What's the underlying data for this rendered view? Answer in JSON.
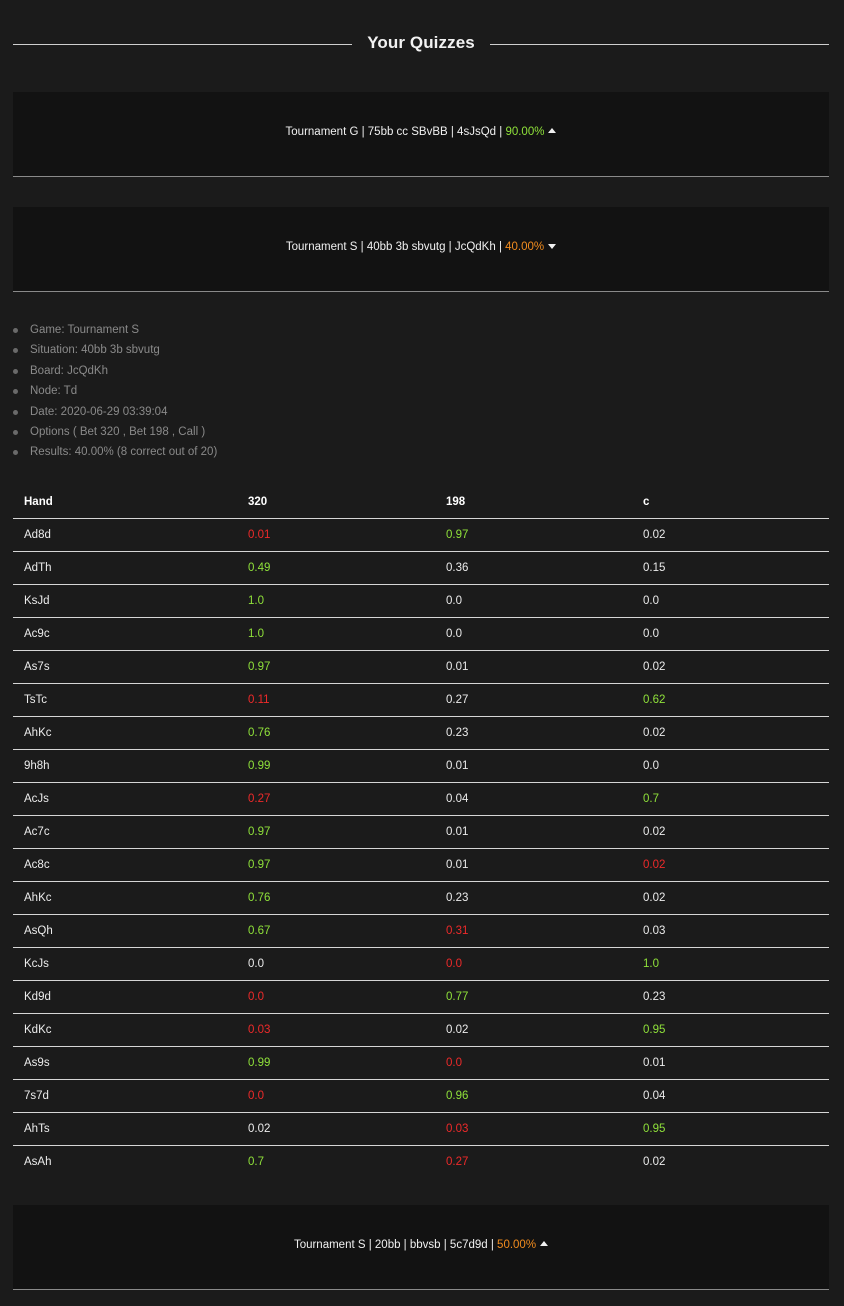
{
  "page": {
    "title": "Your Quizzes"
  },
  "colors": {
    "good": "#8fe13a",
    "bad": "#ee2a2a",
    "mid": "#f28c1e",
    "text": "#ececec",
    "background": "#1b1b1b",
    "card": "#121212"
  },
  "quizzes": [
    {
      "summary": "Tournament G | 75bb cc SBvBB | 4sJsQd | ",
      "percent": "90.00%",
      "percent_color": "green",
      "caret": "up"
    },
    {
      "summary": "Tournament S | 40bb 3b sbvutg | JcQdKh | ",
      "percent": "40.00%",
      "percent_color": "orange",
      "caret": "down"
    },
    {
      "summary": "Tournament S | 20bb | bbvsb | 5c7d9d | ",
      "percent": "50.00%",
      "percent_color": "orange",
      "caret": "up"
    }
  ],
  "details": {
    "game": "Game: Tournament S",
    "situation": "Situation: 40bb 3b sbvutg",
    "board": "Board: JcQdKh",
    "node": "Node: Td",
    "date": "Date: 2020-06-29 03:39:04",
    "options": "Options ( Bet 320 , Bet 198 , Call )",
    "results": "Results: 40.00% (8 correct out of 20)"
  },
  "table": {
    "headers": [
      "Hand",
      "320",
      "198",
      "c"
    ],
    "rows": [
      {
        "hand": "Ad8d",
        "v1": "0.01",
        "c1": "red",
        "v2": "0.97",
        "c2": "green",
        "v3": "0.02",
        "c3": "white"
      },
      {
        "hand": "AdTh",
        "v1": "0.49",
        "c1": "green",
        "v2": "0.36",
        "c2": "white",
        "v3": "0.15",
        "c3": "white"
      },
      {
        "hand": "KsJd",
        "v1": "1.0",
        "c1": "green",
        "v2": "0.0",
        "c2": "white",
        "v3": "0.0",
        "c3": "white"
      },
      {
        "hand": "Ac9c",
        "v1": "1.0",
        "c1": "green",
        "v2": "0.0",
        "c2": "white",
        "v3": "0.0",
        "c3": "white"
      },
      {
        "hand": "As7s",
        "v1": "0.97",
        "c1": "green",
        "v2": "0.01",
        "c2": "white",
        "v3": "0.02",
        "c3": "white"
      },
      {
        "hand": "TsTc",
        "v1": "0.11",
        "c1": "red",
        "v2": "0.27",
        "c2": "white",
        "v3": "0.62",
        "c3": "green"
      },
      {
        "hand": "AhKc",
        "v1": "0.76",
        "c1": "green",
        "v2": "0.23",
        "c2": "white",
        "v3": "0.02",
        "c3": "white"
      },
      {
        "hand": "9h8h",
        "v1": "0.99",
        "c1": "green",
        "v2": "0.01",
        "c2": "white",
        "v3": "0.0",
        "c3": "white"
      },
      {
        "hand": "AcJs",
        "v1": "0.27",
        "c1": "red",
        "v2": "0.04",
        "c2": "white",
        "v3": "0.7",
        "c3": "green"
      },
      {
        "hand": "Ac7c",
        "v1": "0.97",
        "c1": "green",
        "v2": "0.01",
        "c2": "white",
        "v3": "0.02",
        "c3": "white"
      },
      {
        "hand": "Ac8c",
        "v1": "0.97",
        "c1": "green",
        "v2": "0.01",
        "c2": "white",
        "v3": "0.02",
        "c3": "red"
      },
      {
        "hand": "AhKc",
        "v1": "0.76",
        "c1": "green",
        "v2": "0.23",
        "c2": "white",
        "v3": "0.02",
        "c3": "white"
      },
      {
        "hand": "AsQh",
        "v1": "0.67",
        "c1": "green",
        "v2": "0.31",
        "c2": "red",
        "v3": "0.03",
        "c3": "white"
      },
      {
        "hand": "KcJs",
        "v1": "0.0",
        "c1": "white",
        "v2": "0.0",
        "c2": "red",
        "v3": "1.0",
        "c3": "green"
      },
      {
        "hand": "Kd9d",
        "v1": "0.0",
        "c1": "red",
        "v2": "0.77",
        "c2": "green",
        "v3": "0.23",
        "c3": "white"
      },
      {
        "hand": "KdKc",
        "v1": "0.03",
        "c1": "red",
        "v2": "0.02",
        "c2": "white",
        "v3": "0.95",
        "c3": "green"
      },
      {
        "hand": "As9s",
        "v1": "0.99",
        "c1": "green",
        "v2": "0.0",
        "c2": "red",
        "v3": "0.01",
        "c3": "white"
      },
      {
        "hand": "7s7d",
        "v1": "0.0",
        "c1": "red",
        "v2": "0.96",
        "c2": "green",
        "v3": "0.04",
        "c3": "white"
      },
      {
        "hand": "AhTs",
        "v1": "0.02",
        "c1": "white",
        "v2": "0.03",
        "c2": "red",
        "v3": "0.95",
        "c3": "green"
      },
      {
        "hand": "AsAh",
        "v1": "0.7",
        "c1": "green",
        "v2": "0.27",
        "c2": "red",
        "v3": "0.02",
        "c3": "white"
      }
    ]
  }
}
